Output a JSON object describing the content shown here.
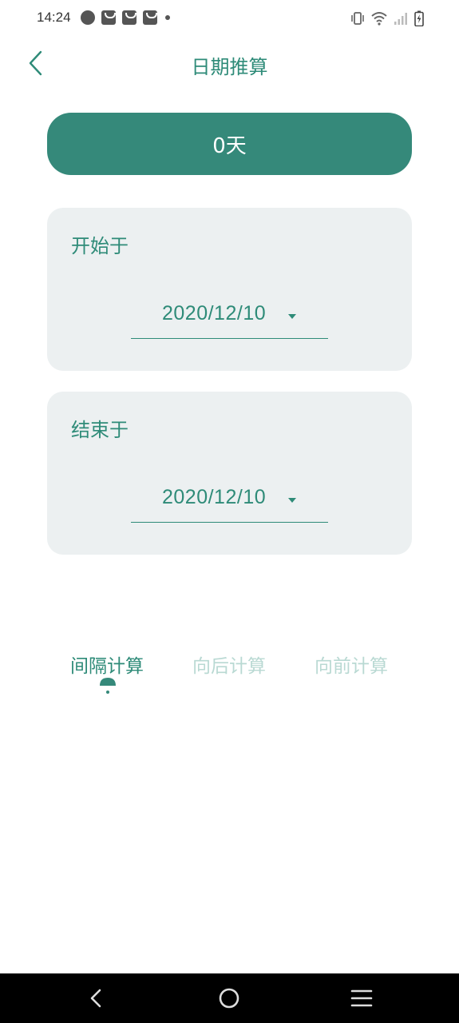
{
  "status_bar": {
    "time": "14:24",
    "left_icons": [
      "speed-icon",
      "bag-icon",
      "bag-icon",
      "bag-icon",
      "dot-icon"
    ],
    "right_icons": [
      "vibrate-icon",
      "wifi-icon",
      "signal-icon",
      "battery-charging-icon"
    ]
  },
  "app_bar": {
    "title": "日期推算",
    "back_icon": "chevron-left-icon"
  },
  "result": {
    "label": "0天"
  },
  "start_card": {
    "label": "开始于",
    "date": "2020/12/10"
  },
  "end_card": {
    "label": "结束于",
    "date": "2020/12/10"
  },
  "tabs": [
    {
      "label": "间隔计算",
      "active": true
    },
    {
      "label": "向后计算",
      "active": false
    },
    {
      "label": "向前计算",
      "active": false
    }
  ],
  "nav_bar": {
    "buttons": [
      "back-icon",
      "home-icon",
      "menu-icon"
    ]
  },
  "colors": {
    "accent": "#35897a",
    "text_primary": "#2e8b78",
    "text_inactive": "#b9d9d3",
    "card_bg": "#ecf0f1",
    "nav_bg": "#000000"
  }
}
